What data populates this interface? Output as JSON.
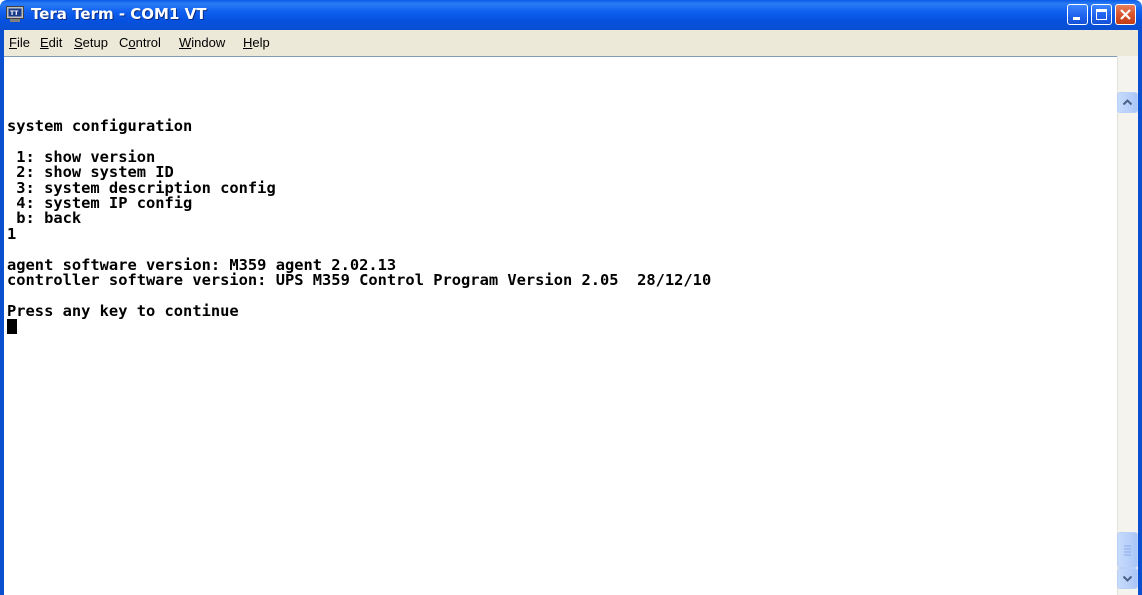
{
  "window": {
    "title": "Tera Term - COM1 VT",
    "icon": "tera-term-icon"
  },
  "title_buttons": {
    "minimize": "minimize-icon",
    "maximize": "maximize-icon",
    "close": "close-icon"
  },
  "menu": {
    "items": [
      {
        "label": "File",
        "mnemonic": "F"
      },
      {
        "label": "Edit",
        "mnemonic": "E"
      },
      {
        "label": "Setup",
        "mnemonic": "S"
      },
      {
        "label": "Control",
        "mnemonic": "o"
      },
      {
        "label": "Window",
        "mnemonic": "W"
      },
      {
        "label": "Help",
        "mnemonic": "H"
      }
    ]
  },
  "terminal": {
    "lines": [
      "system configuration",
      "",
      " 1: show version",
      " 2: show system ID",
      " 3: system description config",
      " 4: system IP config",
      " b: back",
      "1",
      "",
      "agent software version: M359 agent 2.02.13",
      "controller software version: UPS M359 Control Program Version 2.05  28/12/10",
      "",
      "Press any key to continue",
      ""
    ]
  },
  "colors": {
    "titlebar": "#0a5ae8",
    "menubar": "#ece9d8",
    "terminal_bg": "#ffffff",
    "terminal_fg": "#000000",
    "close_button": "#d9552e"
  }
}
